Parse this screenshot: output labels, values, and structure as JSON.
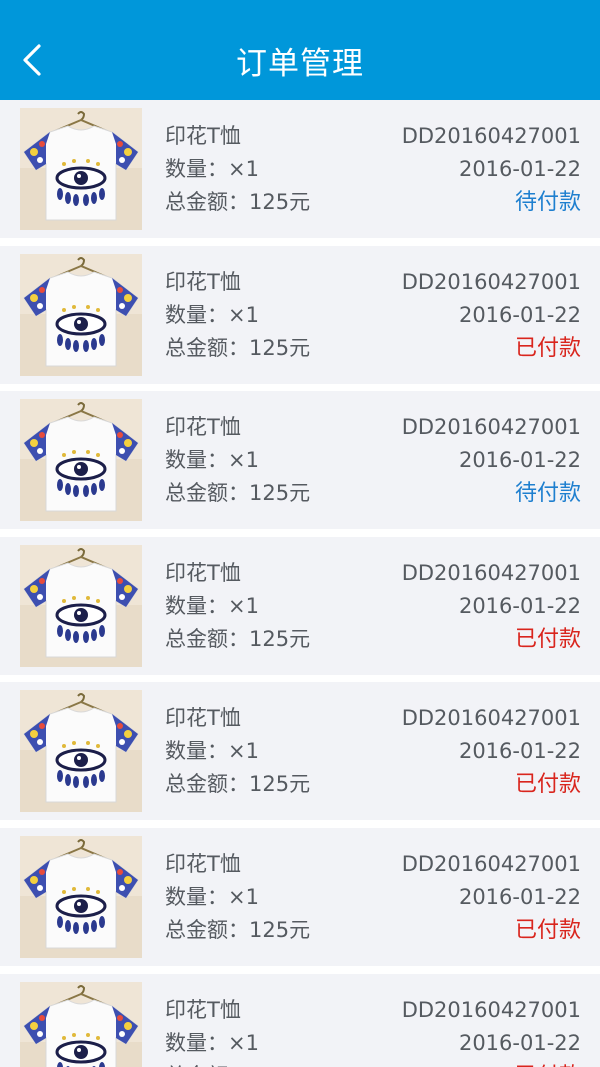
{
  "header": {
    "title": "订单管理",
    "back_icon": "chevron-left-icon",
    "background": "#0097da"
  },
  "labels": {
    "quantity_prefix": "数量：",
    "total_prefix": "总金额："
  },
  "colors": {
    "status_unpaid": "#1e7fcf",
    "status_paid": "#d9251d",
    "row_background": "#f2f3f7"
  },
  "orders": [
    {
      "product_name": "印花T恤",
      "quantity": "×1",
      "total": "125元",
      "order_id": "DD20160427001",
      "date": "2016-01-22",
      "status": "待付款",
      "status_type": "unpaid"
    },
    {
      "product_name": "印花T恤",
      "quantity": "×1",
      "total": "125元",
      "order_id": "DD20160427001",
      "date": "2016-01-22",
      "status": "已付款",
      "status_type": "paid"
    },
    {
      "product_name": "印花T恤",
      "quantity": "×1",
      "total": "125元",
      "order_id": "DD20160427001",
      "date": "2016-01-22",
      "status": "待付款",
      "status_type": "unpaid"
    },
    {
      "product_name": "印花T恤",
      "quantity": "×1",
      "total": "125元",
      "order_id": "DD20160427001",
      "date": "2016-01-22",
      "status": "已付款",
      "status_type": "paid"
    },
    {
      "product_name": "印花T恤",
      "quantity": "×1",
      "total": "125元",
      "order_id": "DD20160427001",
      "date": "2016-01-22",
      "status": "已付款",
      "status_type": "paid"
    },
    {
      "product_name": "印花T恤",
      "quantity": "×1",
      "total": "125元",
      "order_id": "DD20160427001",
      "date": "2016-01-22",
      "status": "已付款",
      "status_type": "paid"
    },
    {
      "product_name": "印花T恤",
      "quantity": "×1",
      "total": "125元",
      "order_id": "DD20160427001",
      "date": "2016-01-22",
      "status": "已付款",
      "status_type": "paid"
    }
  ]
}
